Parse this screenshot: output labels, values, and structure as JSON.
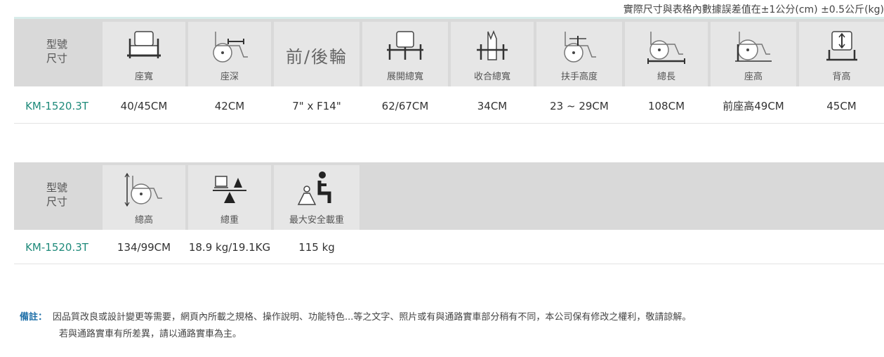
{
  "top_note": "實際尺寸與表格內數據誤差值在±1公分(cm) ±0.5公斤(kg)",
  "table1": {
    "header_label_lines": [
      "型號",
      "尺寸"
    ],
    "columns": [
      {
        "label": "座寬",
        "icon": "seat-width-icon"
      },
      {
        "label": "座深",
        "icon": "seat-depth-icon"
      },
      {
        "label": "前/後輪",
        "icon": null
      },
      {
        "label": "展開總寬",
        "icon": "unfolded-width-icon"
      },
      {
        "label": "收合總寬",
        "icon": "folded-width-icon"
      },
      {
        "label": "扶手高度",
        "icon": "armrest-height-icon"
      },
      {
        "label": "總長",
        "icon": "total-length-icon"
      },
      {
        "label": "座高",
        "icon": "seat-height-icon"
      },
      {
        "label": "背高",
        "icon": "back-height-icon"
      }
    ],
    "row": {
      "model": "KM-1520.3T",
      "values": [
        "40/45CM",
        "42CM",
        "7\" x F14\"",
        "62/67CM",
        "34CM",
        "23 ~ 29CM",
        "108CM",
        "前座高49CM",
        "45CM"
      ]
    }
  },
  "table2": {
    "header_label_lines": [
      "型號",
      "尺寸"
    ],
    "columns": [
      {
        "label": "總高",
        "icon": "total-height-icon"
      },
      {
        "label": "總重",
        "icon": "total-weight-icon"
      },
      {
        "label": "最大安全載重",
        "icon": "max-load-icon"
      }
    ],
    "row": {
      "model": "KM-1520.3T",
      "values": [
        "134/99CM",
        "18.9 kg/19.1KG",
        "115 kg"
      ]
    }
  },
  "footnote": {
    "lead": "備註：",
    "line1": "因品質改良或設計變更等需要，網頁內所載之規格、操作說明、功能特色...等之文字、照片或有與通路實車部分稍有不同，本公司保有修改之權利，敬請諒解。",
    "line2": "若與通路實車有所差異，請以通路實車為主。"
  }
}
